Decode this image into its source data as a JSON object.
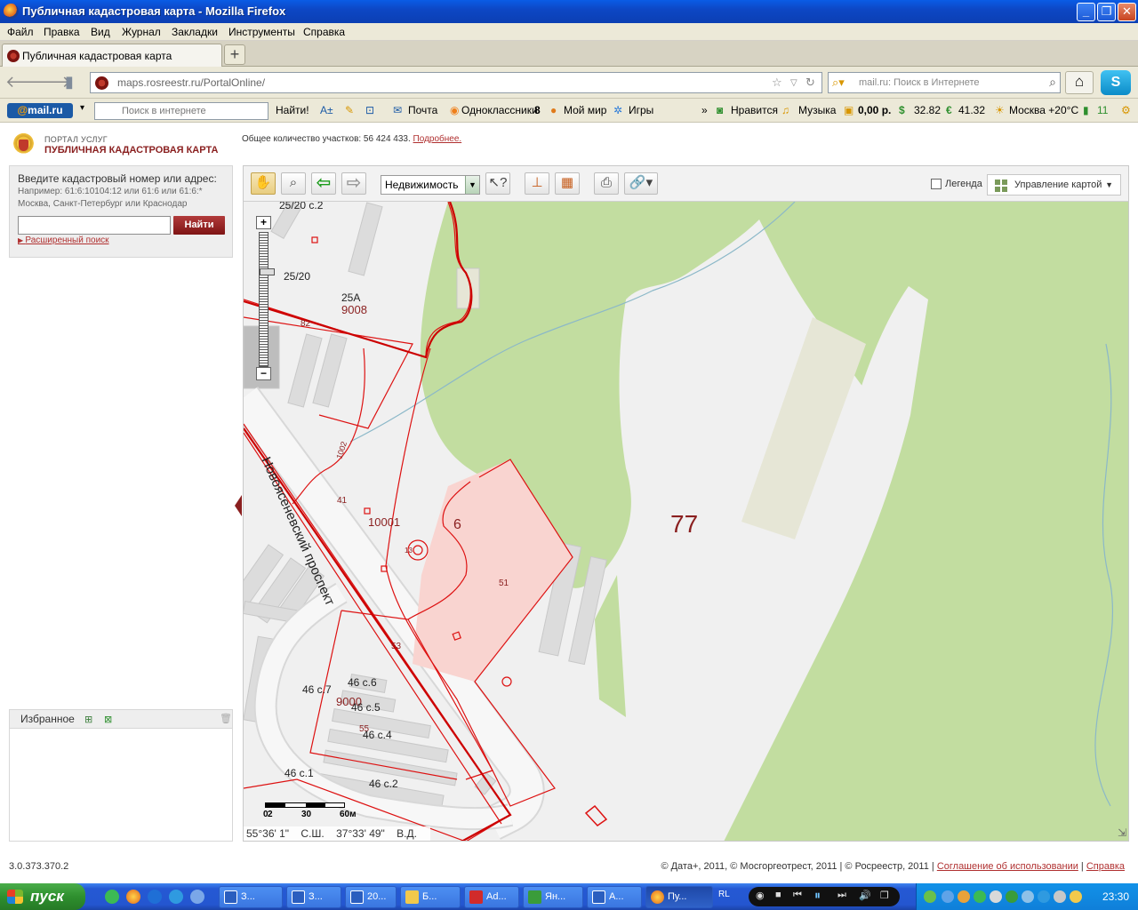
{
  "browser": {
    "window_title": "Публичная кадастровая карта - Mozilla Firefox",
    "menu": [
      "Файл",
      "Правка",
      "Вид",
      "Журнал",
      "Закладки",
      "Инструменты",
      "Справка"
    ],
    "tab_title": "Публичная кадастровая карта",
    "new_tab": "+",
    "url": "maps.rosreestr.ru/PortalOnline/",
    "search_placeholder": "mail.ru: Поиск в Интернете"
  },
  "mailru_toolbar": {
    "logo_at": "@",
    "logo": "mail.ru",
    "search_placeholder": "Поиск в интернете",
    "search_button": "Найти!",
    "mail": "Почта",
    "odnoklassniki": "Одноклассники",
    "odnoklassniki_count": "8",
    "moi_mir": "Мой мир",
    "games": "Игры",
    "more": "»",
    "like": "Нравится",
    "music": "Музыка",
    "balance": "0,00 р.",
    "usd": "32.82",
    "eur": "41.32",
    "weather": "Москва +20°С",
    "traffic": "11"
  },
  "portal": {
    "label_top": "ПОРТАЛ УСЛУГ",
    "label_main": "ПУБЛИЧНАЯ КАДАСТРОВАЯ КАРТА",
    "total_text": "Общее количество участков: 56 424 433.",
    "more_link": "Подробнее."
  },
  "search_panel": {
    "title": "Введите кадастровый номер или адрес:",
    "hint": "Например: 61:6:10104:12 или 61:6 или 61:6:* Москва, Санкт-Петербург или Краснодар",
    "button": "Найти",
    "advanced": "Расширенный поиск"
  },
  "favorites": {
    "title": "Избранное"
  },
  "map_toolbar": {
    "layer": "Недвижимость",
    "legend": "Легенда",
    "map_control": "Управление картой"
  },
  "map_labels": {
    "street": "Новоясеневский проспект",
    "labels": [
      "25/20 с.2",
      "25/20",
      "25А",
      "9008",
      "82",
      "1002",
      "41",
      "10001",
      "6",
      "13",
      "51",
      "53",
      "77",
      "46 с.6",
      "46 с.7",
      "9000",
      "46 с.5",
      "55",
      "46 с.4",
      "46 с.1",
      "46 с.2"
    ]
  },
  "scale": {
    "zero": "0",
    "two": "2",
    "mid": "30",
    "end": "60м"
  },
  "coords": {
    "lat": "55°36' 1\"",
    "lat_hemi": "С.Ш.",
    "lon": "37°33' 49\"",
    "lon_hemi": "В.Д."
  },
  "footer": {
    "version": "3.0.373.370.2",
    "copyright": "© Дата+, 2011, © Мосгоргеотрест, 2011 | © Росреестр, 2011 |",
    "terms": "Соглашение об использовании",
    "separator": "|",
    "help": "Справка"
  },
  "taskbar": {
    "start": "пуск",
    "tasks": [
      "З...",
      "З...",
      "20...",
      "Б...",
      "Ad...",
      "Ян...",
      "А...",
      "Пу..."
    ],
    "lang": "RL",
    "time": "23:30"
  },
  "colors": {
    "title_blue": "#0d47c5",
    "portal_red": "#8a1f1f",
    "forest_green": "#c2dda0",
    "map_bg": "#f0f0f0",
    "parcel_red": "#dd1111",
    "parcel_fill": "#f9d4d0"
  }
}
